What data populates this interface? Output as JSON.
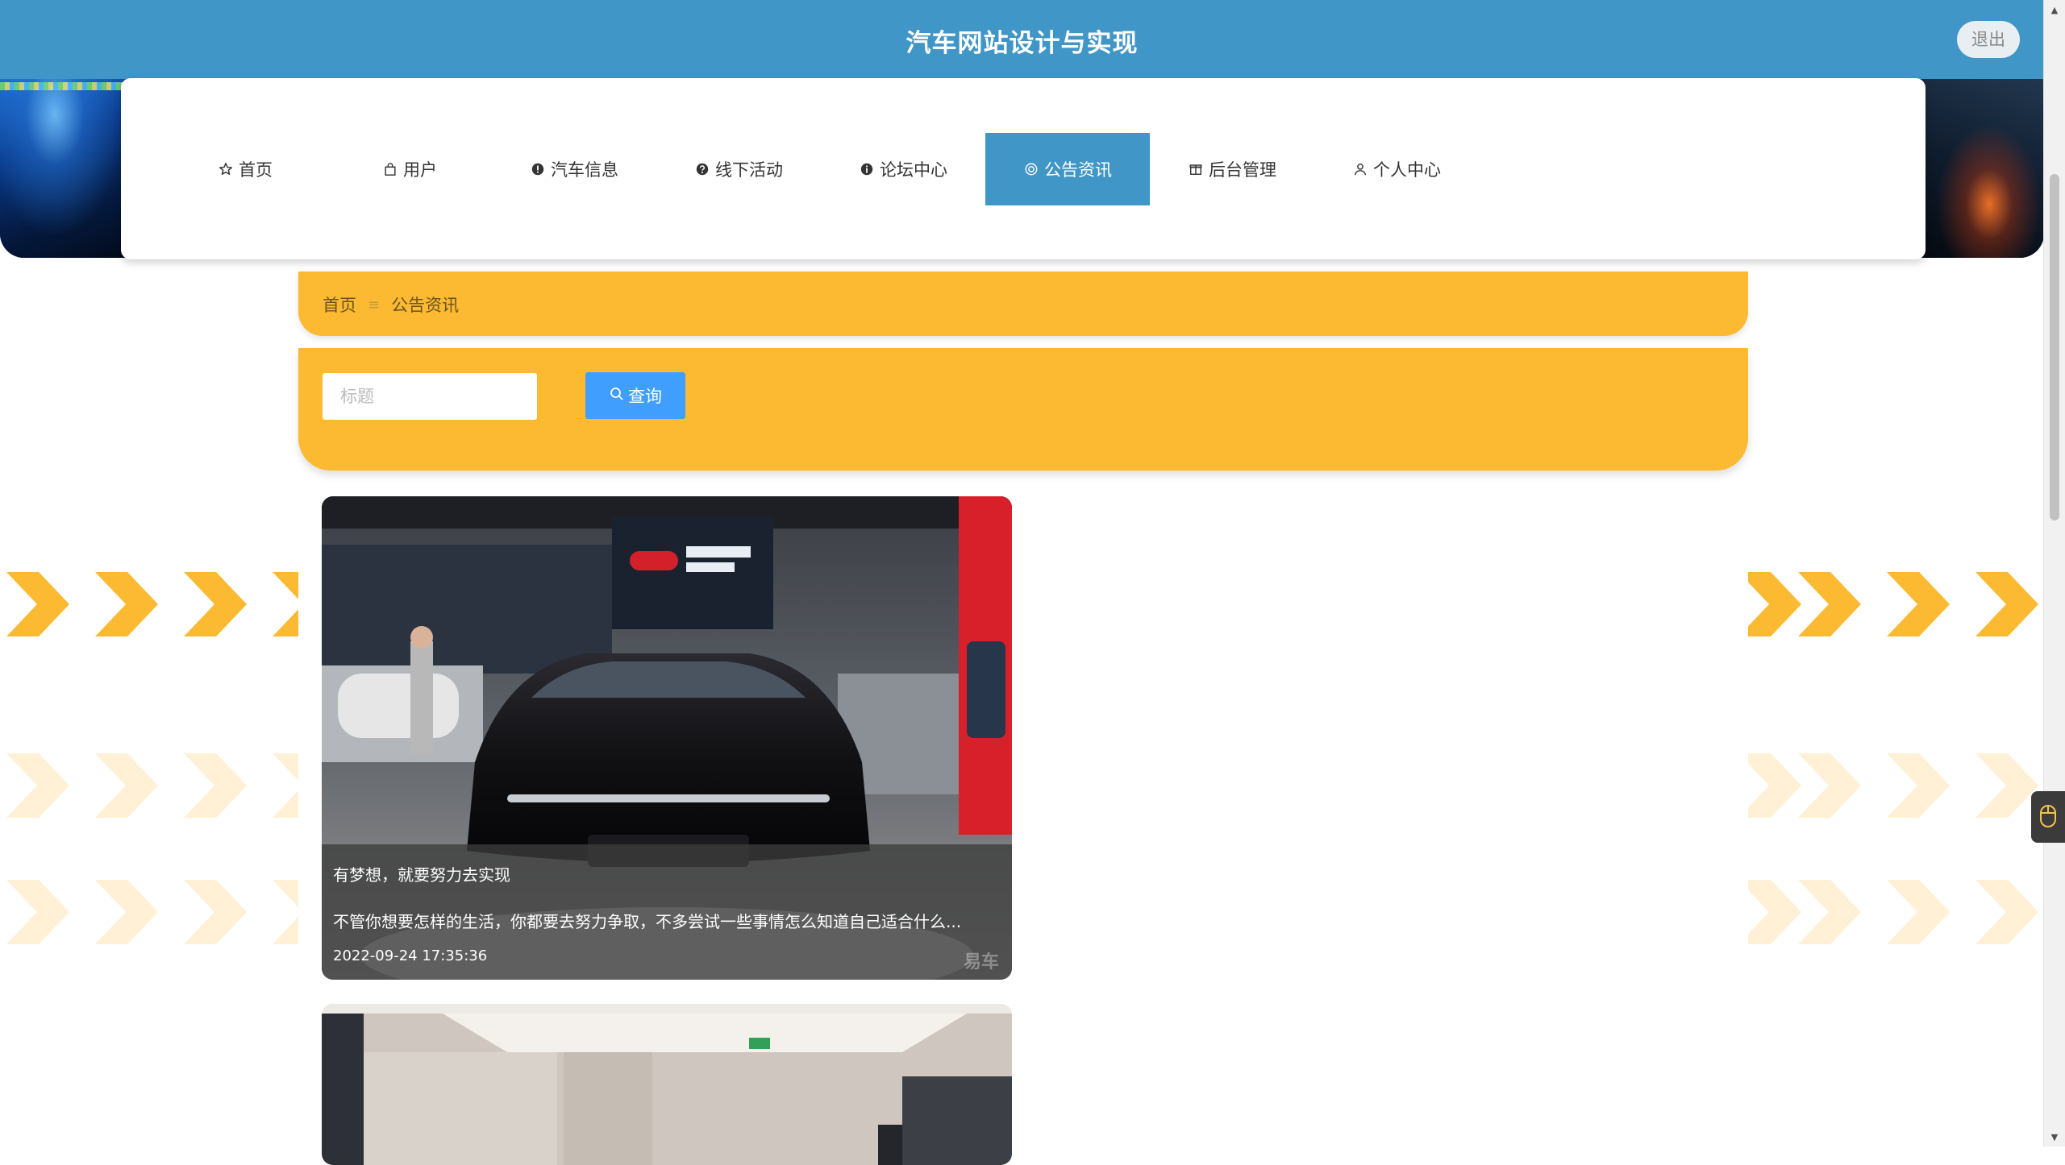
{
  "header": {
    "title": "汽车网站设计与实现",
    "logout_label": "退出"
  },
  "nav": {
    "active": "公告资讯",
    "items": [
      {
        "label": "首页",
        "icon": "star-icon"
      },
      {
        "label": "用户",
        "icon": "bag-icon"
      },
      {
        "label": "汽车信息",
        "icon": "info-circle-icon"
      },
      {
        "label": "线下活动",
        "icon": "question-circle-icon"
      },
      {
        "label": "论坛中心",
        "icon": "info-circle-icon"
      },
      {
        "label": "公告资讯",
        "icon": "circle-icon"
      },
      {
        "label": "后台管理",
        "icon": "gift-icon"
      },
      {
        "label": "个人中心",
        "icon": "user-icon"
      }
    ]
  },
  "breadcrumb": {
    "home": "首页",
    "separator": "≡",
    "current": "公告资讯"
  },
  "search": {
    "placeholder": "标题",
    "value": "",
    "button_label": "查询"
  },
  "news": [
    {
      "title": "有梦想，就要努力去实现",
      "summary": "不管你想要怎样的生活，你都要去努力争取，不多尝试一些事情怎么知道自己适合什么...",
      "date": "2022-09-24 17:35:36",
      "watermark": "易车"
    }
  ],
  "colors": {
    "primary": "#4096c7",
    "accent": "#fcb932",
    "button": "#409eff"
  }
}
